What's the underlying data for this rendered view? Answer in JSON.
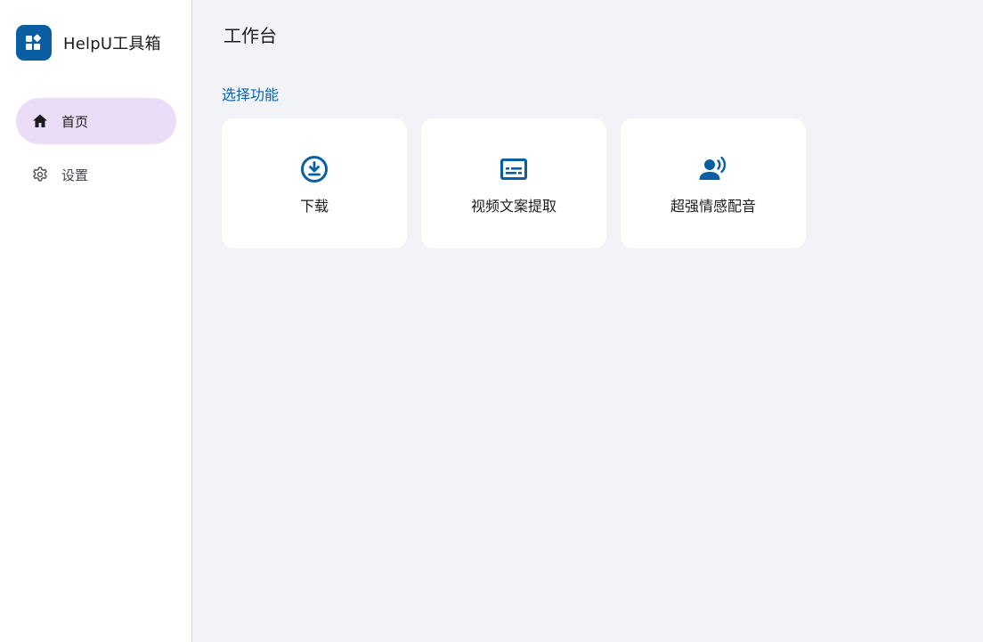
{
  "app": {
    "name": "HelpU工具箱",
    "logo_icon": "widgets-icon",
    "accent_color": "#0a5fa3"
  },
  "sidebar": {
    "items": [
      {
        "label": "首页",
        "icon": "home-icon",
        "active": true
      },
      {
        "label": "设置",
        "icon": "gear-icon",
        "active": false
      }
    ],
    "active_bg": "#ebddf7"
  },
  "main": {
    "title": "工作台",
    "section_title": "选择功能",
    "cards": [
      {
        "label": "下载",
        "icon": "download-circle-icon"
      },
      {
        "label": "视频文案提取",
        "icon": "subtitles-icon"
      },
      {
        "label": "超强情感配音",
        "icon": "voice-over-icon"
      }
    ]
  }
}
